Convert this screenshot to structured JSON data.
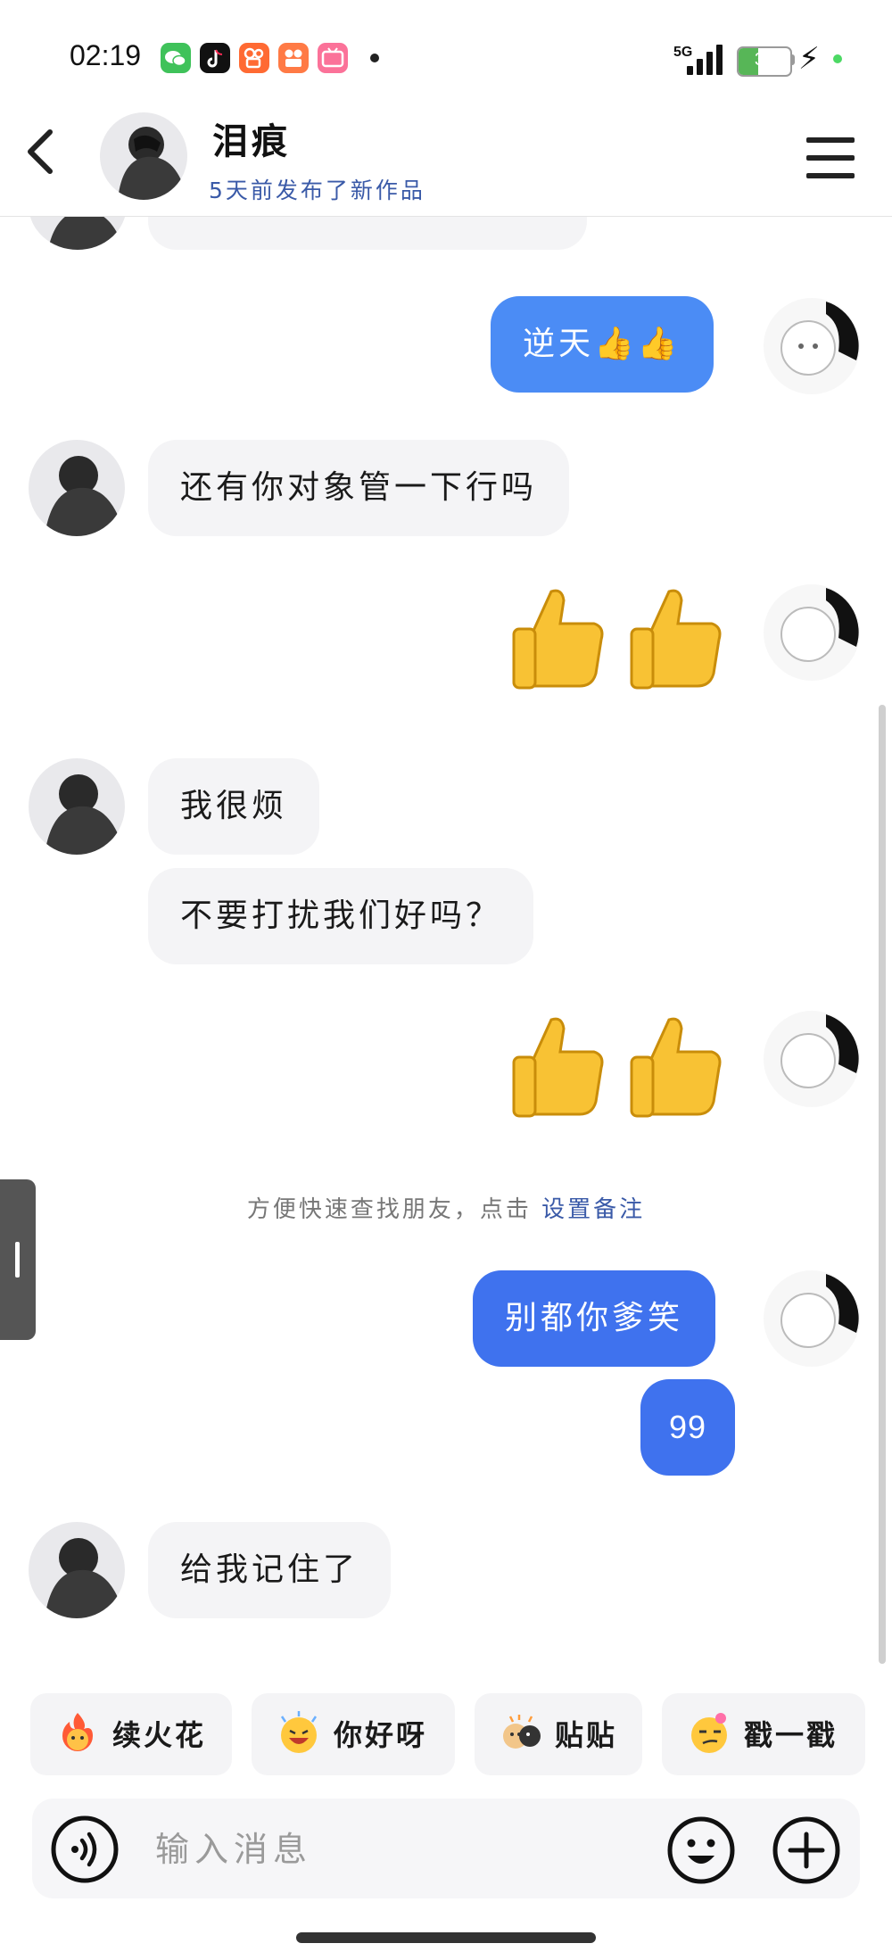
{
  "status_bar": {
    "time": "02:19",
    "network": "5G",
    "battery": "38",
    "battery_level": 0.38,
    "apps": [
      "wechat-icon",
      "tiktok-icon",
      "kuaishou-icon",
      "app-icon",
      "bilibili-icon"
    ]
  },
  "header": {
    "name": "泪痕",
    "status": "5天前发布了新作品"
  },
  "messages": [
    {
      "side": "out",
      "text": "逆天👍👍"
    },
    {
      "side": "in",
      "text": "还有你对象管一下行吗"
    },
    {
      "side": "out",
      "emoji": "👍👍"
    },
    {
      "side": "in",
      "text": "我很烦"
    },
    {
      "side": "in",
      "text": "不要打扰我们好吗？"
    },
    {
      "side": "out",
      "emoji": "👍👍"
    },
    {
      "side": "system",
      "text": "方便快速查找朋友，点击",
      "link": "设置备注"
    },
    {
      "side": "out",
      "text": "别都你爹笑"
    },
    {
      "side": "out",
      "text": "99"
    },
    {
      "side": "in",
      "text": "给我记住了"
    }
  ],
  "quick_replies": [
    {
      "icon": "fire-face-icon",
      "label": "续火花"
    },
    {
      "icon": "laughing-face-icon",
      "label": "你好呀"
    },
    {
      "icon": "dog-sticker-icon",
      "label": "贴贴"
    },
    {
      "icon": "smirk-face-icon",
      "label": "戳一戳"
    }
  ],
  "input": {
    "placeholder": "输入消息",
    "value": ""
  },
  "colors": {
    "outgoing_bubble": "#4b8cf5",
    "incoming_bubble": "#f4f4f6",
    "link": "#3a5aa8"
  }
}
